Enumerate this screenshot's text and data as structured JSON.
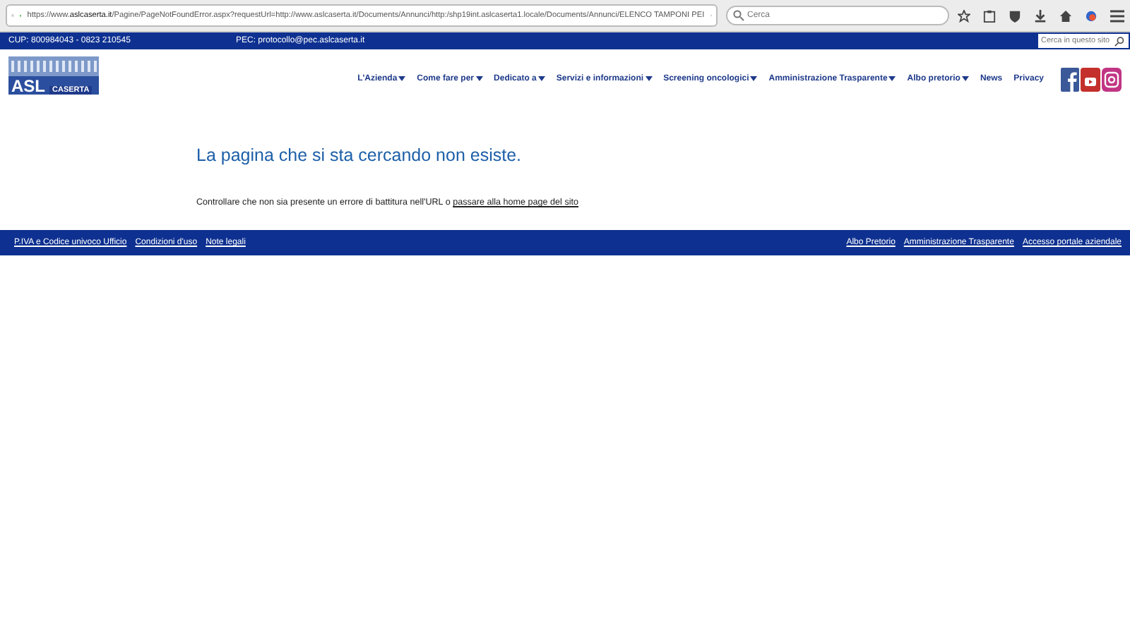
{
  "browser": {
    "url_prefix": "https://www.",
    "url_domain": "aslcaserta.it",
    "url_rest": "/Pagine/PageNotFoundError.aspx?requestUrl=http://www.aslcaserta.it/Documents/Annunci/http:/shp19int.aslcaserta1.locale/Documents/Annunci/ELENCO TAMPONI PEI",
    "search_placeholder": "Cerca"
  },
  "top_bar": {
    "cup": "CUP: 800984043 - 0823 210545",
    "pec": "PEC: protocollo@pec.aslcaserta.it",
    "search_placeholder": "Cerca in questo sito"
  },
  "logo": {
    "name": "ASL",
    "place": "CASERTA"
  },
  "nav": [
    {
      "label": "L'Azienda",
      "has_menu": true
    },
    {
      "label": "Come fare per",
      "has_menu": true
    },
    {
      "label": "Dedicato a",
      "has_menu": true
    },
    {
      "label": "Servizi e informazioni",
      "has_menu": true
    },
    {
      "label": "Screening oncologici",
      "has_menu": true
    },
    {
      "label": "Amministrazione Trasparente",
      "has_menu": true
    },
    {
      "label": "Albo pretorio",
      "has_menu": true
    },
    {
      "label": "News",
      "has_menu": false
    },
    {
      "label": "Privacy",
      "has_menu": false
    }
  ],
  "content": {
    "title": "La pagina che si sta cercando non esiste.",
    "message": "Controllare che non sia presente un errore di battitura nell'URL o",
    "link": "passare alla home page del sito"
  },
  "footer": {
    "left_links": [
      "P.IVA e Codice univoco Ufficio",
      "Condizioni d'uso",
      "Note legali"
    ],
    "right_links": [
      "Albo Pretorio",
      "Amministrazione Trasparente",
      "Accesso portale aziendale"
    ]
  }
}
